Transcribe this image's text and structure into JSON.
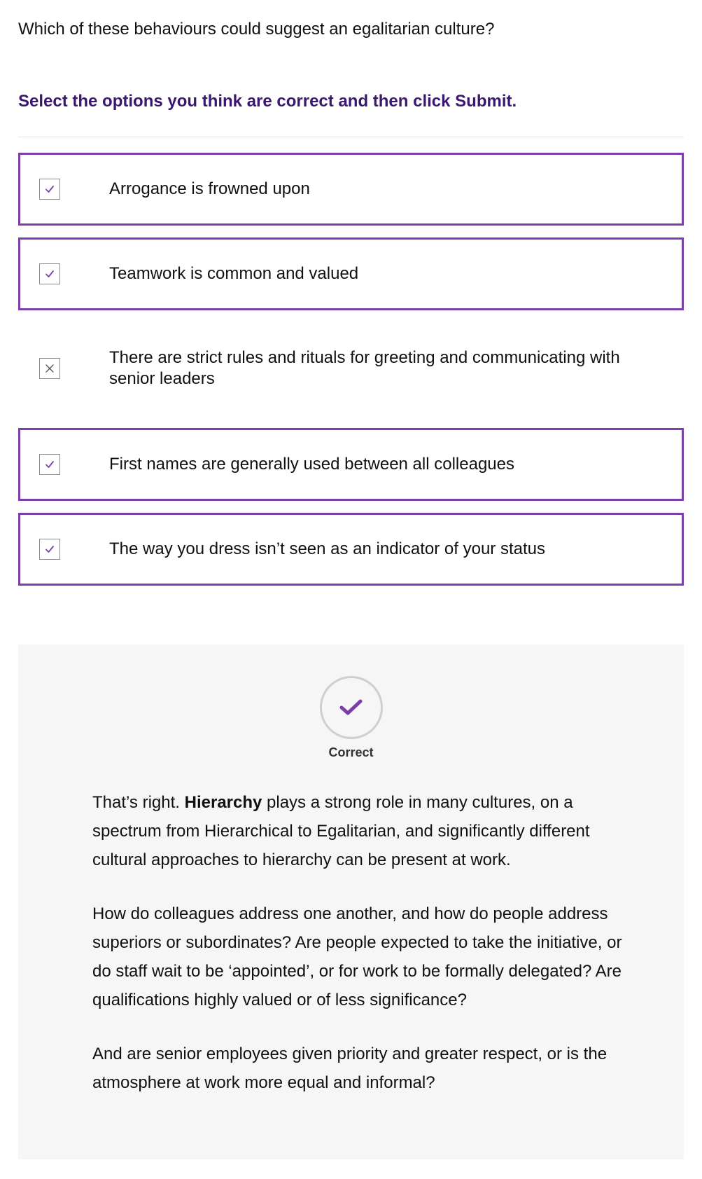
{
  "question": "Which of these behaviours could suggest an egalitarian culture?",
  "instruction": "Select the options you think are correct and then click Submit.",
  "options": [
    {
      "label": "Arrogance is frowned upon",
      "state": "checked"
    },
    {
      "label": "Teamwork is common and valued",
      "state": "checked"
    },
    {
      "label": "There are strict rules and rituals for greeting and communicating with senior leaders",
      "state": "crossed"
    },
    {
      "label": "First names are generally used between all colleagues",
      "state": "checked"
    },
    {
      "label": "The way you dress isn’t seen as an indicator of your status",
      "state": "checked"
    }
  ],
  "feedback": {
    "result": "Correct",
    "p1_before": "That’s right. ",
    "p1_bold": "Hierarchy",
    "p1_after": " plays a strong role in many cultures, on a spectrum from Hierarchical to Egalitarian, and significantly different cultural approaches to hierarchy can be present at work.",
    "p2": "How do colleagues address one another, and how do people address superiors or subordinates?  Are people expected to take the initiative, or do staff wait to be ‘appointed’, or for work to be formally delegated? Are qualifications highly valued or of less significance?",
    "p3": "And are senior employees given priority and greater respect, or is the atmosphere at work more equal and informal?"
  },
  "colors": {
    "accent": "#7a3fa9",
    "instruction": "#3c1673",
    "feedback_bg": "#f6f6f6"
  }
}
